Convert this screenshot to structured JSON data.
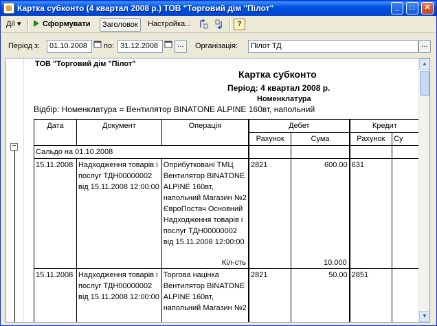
{
  "window": {
    "title": "Картка субконто (4 квартал 2008 р.) ТОВ \"Торговий дім \"Пілот\"",
    "minimize": "_",
    "maximize": "□",
    "close": "✕"
  },
  "toolbar": {
    "actions_label": "Дії",
    "actions_arrow": "▾",
    "generate_label": "Сформувати",
    "header_label": "Заголовок",
    "settings_label": "Настройка...",
    "help_glyph": "?"
  },
  "filters": {
    "period_from_label": "Період з:",
    "period_from_value": "01.10.2008",
    "period_to_label": "по:",
    "period_to_value": "31.12.2008",
    "dots": "...",
    "org_label": "Організація:",
    "org_value": "Пілот ТД",
    "org_dots": "..."
  },
  "report": {
    "org_name": "ТОВ \"Торговий дім \"Пілот\"",
    "title": "Картка субконто",
    "period": "Період: 4 квартал 2008 р.",
    "subtitle": "Номенклатура",
    "filter": "Відбір: Номенклатура = Вентилятор BINATONE ALPINE 160вт, напольний",
    "headers": {
      "date": "Дата",
      "document": "Документ",
      "operation": "Операція",
      "debit": "Дебет",
      "credit": "Кредит",
      "debit_account": "Рахунок",
      "debit_sum": "Сума",
      "credit_account": "Рахунок",
      "credit_sum": "Су"
    },
    "opening_balance": "Сальдо на 01.10.2008",
    "rows": [
      {
        "date": "15.11.2008",
        "document": "Надходження товарів і послуг ТДН00000002 від 15.11.2008 12:00:00",
        "operation": "Оприбутковані ТМЦ Вентилятор BINATONE ALPINE 160вт, напольний Магазин №2 ЄвроПостач Основний Надходження товарів і послуг ТДН00000002 від 15.11.2008 12:00:00",
        "qty_label": "Кіл-сть",
        "debit_account": "2821",
        "debit_sum": "600.00",
        "debit_qty": "10.000",
        "credit_account": "631"
      },
      {
        "date": "15.11.2008",
        "document": "Надходження товарів і послуг ТДН00000002 від 15.11.2008 12:00:00",
        "operation": "Торгова націнка Вентилятор BINATONE ALPINE 160вт, напольний Магазин №2",
        "debit_account": "2821",
        "debit_sum": "50.00",
        "credit_account": "2851"
      }
    ]
  },
  "scroll": {
    "up": "▲",
    "down": "▼"
  },
  "colors": {
    "titlebar": "#0054e3",
    "window": "#ece9d8",
    "field_border": "#7f9db9"
  }
}
